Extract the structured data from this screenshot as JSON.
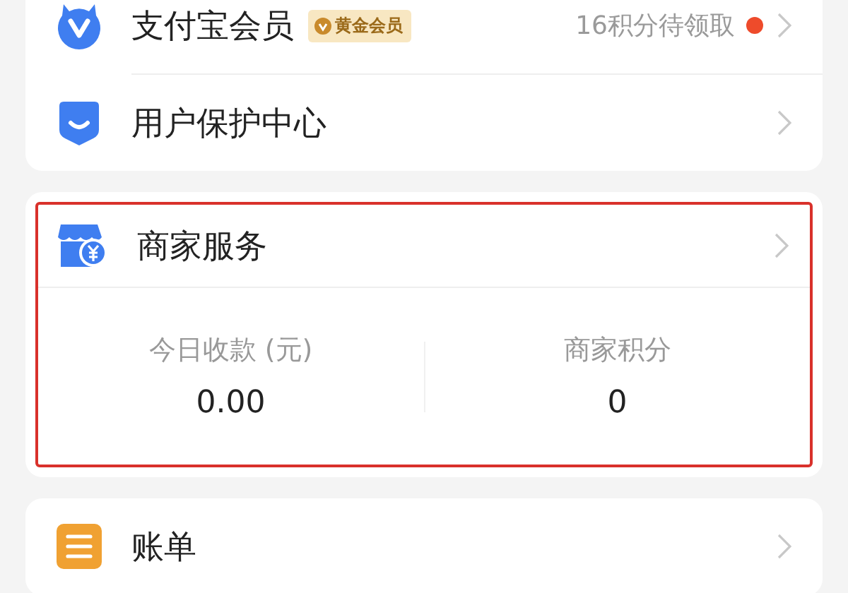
{
  "member_card": {
    "rows": [
      {
        "kind": "member",
        "title": "支付宝会员",
        "badge": "黄金会员",
        "note": "16积分待领取",
        "unread": true
      },
      {
        "kind": "protection",
        "title": "用户保护中心"
      }
    ]
  },
  "merchant": {
    "kind": "shop",
    "title": "商家服务",
    "highlighted": true,
    "stats": [
      {
        "label": "今日收款 (元)",
        "value": "0.00"
      },
      {
        "label": "商家积分",
        "value": "0"
      }
    ]
  },
  "bill_card": {
    "rows": [
      {
        "kind": "bill",
        "title": "账单"
      }
    ]
  }
}
